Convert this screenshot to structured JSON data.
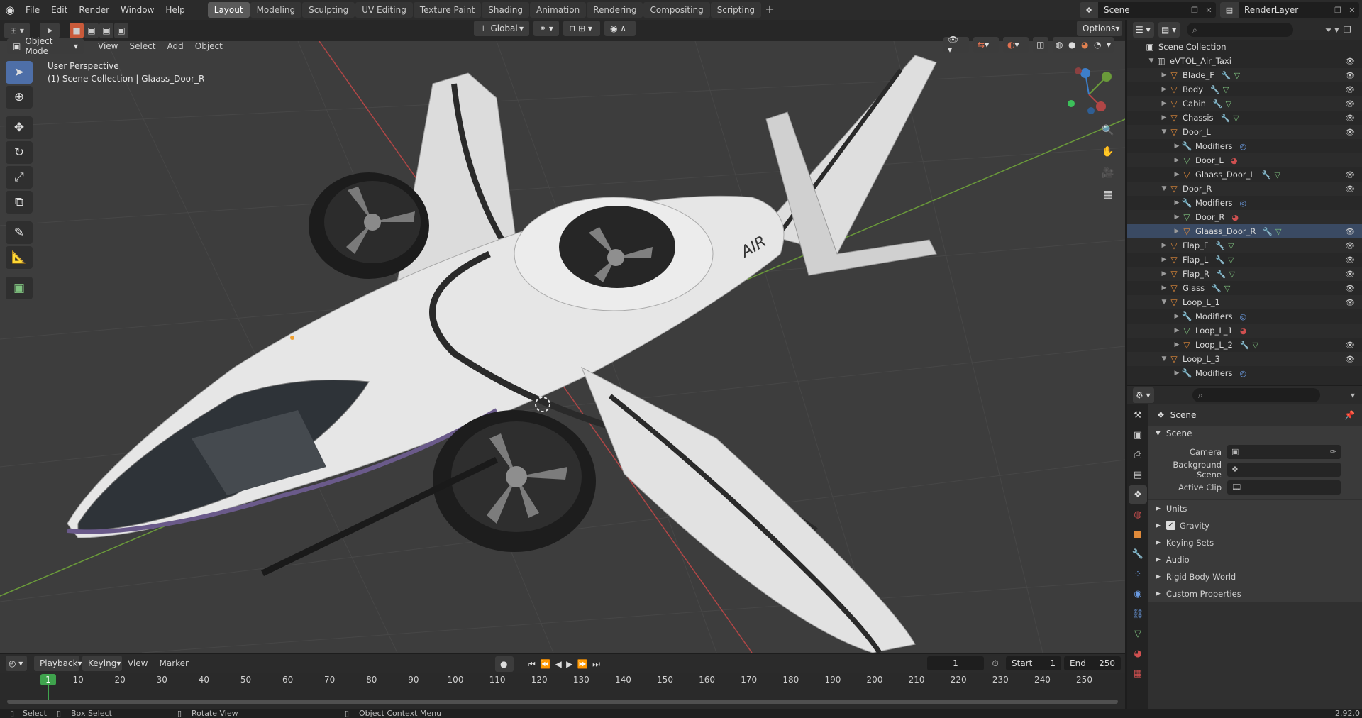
{
  "topbar": {
    "menus": [
      "File",
      "Edit",
      "Render",
      "Window",
      "Help"
    ],
    "workspaces": [
      "Layout",
      "Modeling",
      "Sculpting",
      "UV Editing",
      "Texture Paint",
      "Shading",
      "Animation",
      "Rendering",
      "Compositing",
      "Scripting"
    ],
    "active_workspace": "Layout",
    "scene_name": "Scene",
    "view_layer": "RenderLayer"
  },
  "viewport_header": {
    "mode": "Object Mode",
    "menus": [
      "View",
      "Select",
      "Add",
      "Object"
    ],
    "orientation": "Global",
    "options_label": "Options"
  },
  "viewport": {
    "view_name": "User Perspective",
    "context": "(1) Scene Collection | Glaass_Door_R",
    "decal_text": "AIR",
    "colors": {
      "background": "#3d3d3d",
      "grid": "#4a4a4a",
      "axis_x": "#b04646",
      "axis_y": "#6a9a3a",
      "body": "#e6e6e6",
      "stripe": "#2a2a2a"
    }
  },
  "outliner": {
    "root": "Scene Collection",
    "rows": [
      {
        "label": "eVTOL_Air_Taxi",
        "depth": 0,
        "arrow": "▼",
        "icon": "collection",
        "eye": true,
        "badges": []
      },
      {
        "label": "Blade_F",
        "depth": 1,
        "arrow": "▶",
        "icon": "object",
        "eye": true,
        "badges": [
          "wrench",
          "mesh"
        ]
      },
      {
        "label": "Body",
        "depth": 1,
        "arrow": "▶",
        "icon": "object",
        "eye": true,
        "badges": [
          "wrench",
          "mesh"
        ]
      },
      {
        "label": "Cabin",
        "depth": 1,
        "arrow": "▶",
        "icon": "object",
        "eye": true,
        "badges": [
          "wrench",
          "mesh"
        ]
      },
      {
        "label": "Chassis",
        "depth": 1,
        "arrow": "▶",
        "icon": "object",
        "eye": true,
        "badges": [
          "wrench",
          "mesh"
        ]
      },
      {
        "label": "Door_L",
        "depth": 1,
        "arrow": "▼",
        "icon": "object",
        "eye": true,
        "badges": []
      },
      {
        "label": "Modifiers",
        "depth": 2,
        "arrow": "▶",
        "icon": "wrench",
        "eye": false,
        "badges": [
          "modifier"
        ]
      },
      {
        "label": "Door_L",
        "depth": 2,
        "arrow": "▶",
        "icon": "mesh",
        "eye": false,
        "badges": [
          "material"
        ]
      },
      {
        "label": "Glaass_Door_L",
        "depth": 2,
        "arrow": "▶",
        "icon": "object",
        "eye": true,
        "badges": [
          "wrench",
          "mesh"
        ]
      },
      {
        "label": "Door_R",
        "depth": 1,
        "arrow": "▼",
        "icon": "object",
        "eye": true,
        "badges": []
      },
      {
        "label": "Modifiers",
        "depth": 2,
        "arrow": "▶",
        "icon": "wrench",
        "eye": false,
        "badges": [
          "modifier"
        ]
      },
      {
        "label": "Door_R",
        "depth": 2,
        "arrow": "▶",
        "icon": "mesh",
        "eye": false,
        "badges": [
          "material"
        ]
      },
      {
        "label": "Glaass_Door_R",
        "depth": 2,
        "arrow": "▶",
        "icon": "object",
        "eye": true,
        "badges": [
          "wrench",
          "mesh"
        ],
        "selected": true
      },
      {
        "label": "Flap_F",
        "depth": 1,
        "arrow": "▶",
        "icon": "object",
        "eye": true,
        "badges": [
          "wrench",
          "mesh"
        ]
      },
      {
        "label": "Flap_L",
        "depth": 1,
        "arrow": "▶",
        "icon": "object",
        "eye": true,
        "badges": [
          "wrench",
          "mesh"
        ]
      },
      {
        "label": "Flap_R",
        "depth": 1,
        "arrow": "▶",
        "icon": "object",
        "eye": true,
        "badges": [
          "wrench",
          "mesh"
        ]
      },
      {
        "label": "Glass",
        "depth": 1,
        "arrow": "▶",
        "icon": "object",
        "eye": true,
        "badges": [
          "wrench",
          "mesh"
        ]
      },
      {
        "label": "Loop_L_1",
        "depth": 1,
        "arrow": "▼",
        "icon": "object",
        "eye": true,
        "badges": []
      },
      {
        "label": "Modifiers",
        "depth": 2,
        "arrow": "▶",
        "icon": "wrench",
        "eye": false,
        "badges": [
          "modifier"
        ]
      },
      {
        "label": "Loop_L_1",
        "depth": 2,
        "arrow": "▶",
        "icon": "mesh",
        "eye": false,
        "badges": [
          "material"
        ]
      },
      {
        "label": "Loop_L_2",
        "depth": 2,
        "arrow": "▶",
        "icon": "object",
        "eye": true,
        "badges": [
          "wrench",
          "mesh"
        ]
      },
      {
        "label": "Loop_L_3",
        "depth": 1,
        "arrow": "▼",
        "icon": "object",
        "eye": true,
        "badges": []
      },
      {
        "label": "Modifiers",
        "depth": 2,
        "arrow": "▶",
        "icon": "wrench",
        "eye": false,
        "badges": [
          "modifier"
        ]
      }
    ]
  },
  "properties": {
    "context_title": "Scene",
    "panel_title": "Scene",
    "fields": [
      {
        "label": "Camera",
        "icon": "camera-icon"
      },
      {
        "label": "Background Scene",
        "icon": "scene-icon"
      },
      {
        "label": "Active Clip",
        "icon": "clip-icon"
      }
    ],
    "subpanels": [
      "Units",
      "Gravity",
      "Keying Sets",
      "Audio",
      "Rigid Body World",
      "Custom Properties"
    ],
    "gravity_checked": true
  },
  "timeline": {
    "menus": [
      "Playback",
      "Keying",
      "View",
      "Marker"
    ],
    "current_frame": "1",
    "start_label": "Start",
    "start": "1",
    "end_label": "End",
    "end": "250",
    "ticks": [
      "10",
      "20",
      "30",
      "40",
      "50",
      "60",
      "70",
      "80",
      "90",
      "100",
      "110",
      "120",
      "130",
      "140",
      "150",
      "160",
      "170",
      "180",
      "190",
      "200",
      "210",
      "220",
      "230",
      "240",
      "250"
    ],
    "cursor_label": "1"
  },
  "statusbar": {
    "select": "Select",
    "box_select": "Box Select",
    "rotate_view": "Rotate View",
    "context_menu": "Object Context Menu",
    "version": "2.92.0"
  }
}
